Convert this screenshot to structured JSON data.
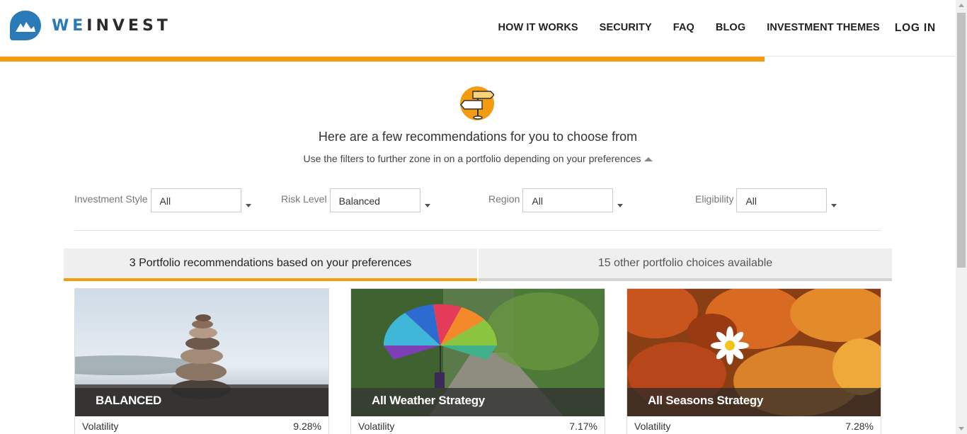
{
  "brand": {
    "we": "WE",
    "invest": "INVEST"
  },
  "nav": [
    "HOW IT WORKS",
    "SECURITY",
    "FAQ",
    "BLOG",
    "INVESTMENT THEMES"
  ],
  "login": "LOG IN",
  "progress": 0.8,
  "accent_color": "#f39c12",
  "brand_color": "#2a7ab8",
  "hero": {
    "icon": "signpost-icon",
    "headline": "Here are a few recommendations for you to choose from",
    "subline": "Use the filters to further zone in on a portfolio depending on your preferences"
  },
  "filters": [
    {
      "label": "Investment Style",
      "value": "All"
    },
    {
      "label": "Risk Level",
      "value": "Balanced"
    },
    {
      "label": "Region",
      "value": "All"
    },
    {
      "label": "Eligibility",
      "value": "All"
    }
  ],
  "tabs": {
    "recommended": "3 Portfolio recommendations based on your preferences",
    "other": "15 other portfolio choices available"
  },
  "cards": [
    {
      "title": "BALANCED",
      "stat_label": "Volatility",
      "stat_value": "9.28%"
    },
    {
      "title": "All Weather Strategy",
      "stat_label": "Volatility",
      "stat_value": "7.17%"
    },
    {
      "title": "All Seasons Strategy",
      "stat_label": "Volatility",
      "stat_value": "7.28%"
    }
  ]
}
